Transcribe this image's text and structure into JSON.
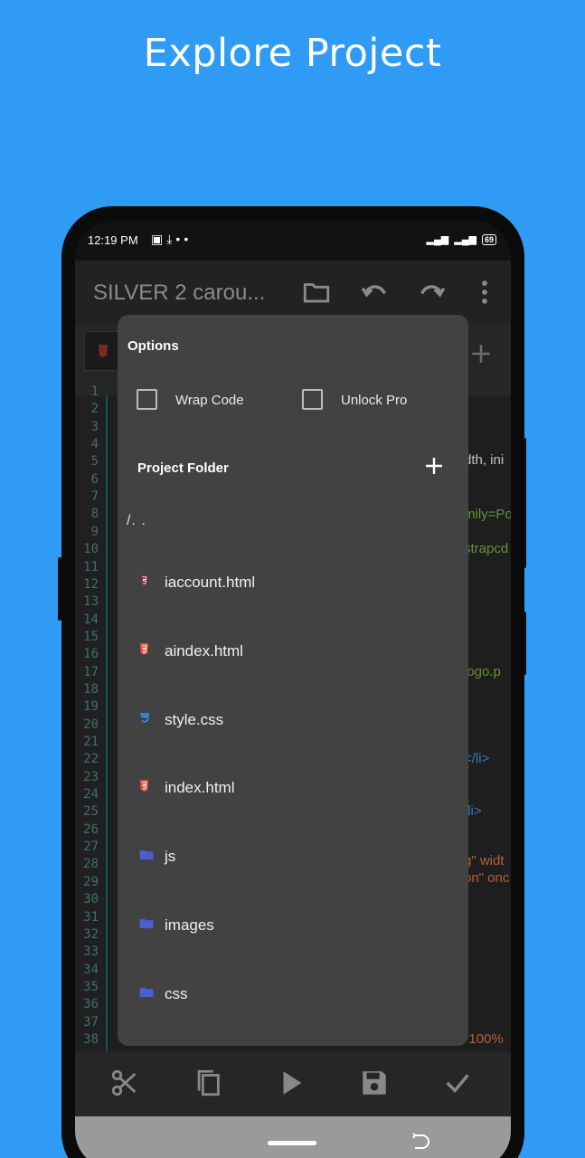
{
  "headline": "Explore Project",
  "status": {
    "time": "12:19 PM",
    "battery": "69"
  },
  "appbar": {
    "title": "SILVER 2 carou..."
  },
  "editor": {
    "line_numbers": [
      "1",
      "2",
      "3",
      "4",
      "5",
      "6",
      "7",
      "8",
      "9",
      "10",
      "11",
      "12",
      "13",
      "14",
      "15",
      "16",
      "17",
      "18",
      "19",
      "20",
      "21",
      "22",
      "23",
      "24",
      "25",
      "26",
      "27",
      "28",
      "29",
      "30",
      "31",
      "32",
      "33",
      "34",
      "35",
      "36",
      "37",
      "38"
    ],
    "fragments": [
      {
        "text": "dth, ini",
        "color": "#c5c5c5"
      },
      {
        "text": "mily=Po",
        "color": "#6a8f3a"
      },
      {
        "text": "strapcd",
        "color": "#6a8f3a"
      },
      {
        "text": "logo.p",
        "color": "#6a8f3a"
      },
      {
        "text": "</li>",
        "color": "#3a78c2"
      },
      {
        "text": "/li>",
        "color": "#3a78c2"
      },
      {
        "text": "g\" widt",
        "color": "#b5603a"
      },
      {
        "text": "on\" onc",
        "color": "#b5603a"
      },
      {
        "text": "\"100%",
        "color": "#b5603a"
      }
    ]
  },
  "dialog": {
    "title": "Options",
    "wrap_code": "Wrap Code",
    "unlock_pro": "Unlock Pro",
    "project_folder": "Project Folder",
    "parent_dir": "/. .",
    "items": [
      {
        "name": "iaccount.html",
        "type": "html"
      },
      {
        "name": "aindex.html",
        "type": "html"
      },
      {
        "name": "style.css",
        "type": "css"
      },
      {
        "name": "index.html",
        "type": "html"
      },
      {
        "name": "js",
        "type": "folder"
      },
      {
        "name": "images",
        "type": "folder"
      },
      {
        "name": "css",
        "type": "folder"
      }
    ]
  },
  "colors": {
    "background": "#2f9bf4",
    "dialog": "#424242",
    "html_icon": "#e8584a",
    "css_icon": "#3d8af7",
    "folder_icon": "#4a5fd1"
  }
}
